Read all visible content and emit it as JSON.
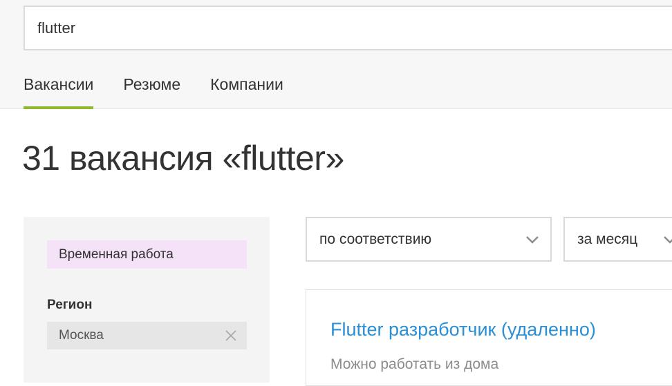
{
  "search": {
    "value": "flutter"
  },
  "tabs": [
    {
      "label": "Вакансии",
      "active": true
    },
    {
      "label": "Резюме",
      "active": false
    },
    {
      "label": "Компании",
      "active": false
    }
  ],
  "page_title": "31 вакансия «flutter»",
  "filters": {
    "tag": "Временная работа",
    "region_label": "Регион",
    "region_value": "Москва"
  },
  "sort": {
    "order": "по соответствию",
    "period": "за месяц"
  },
  "results": [
    {
      "title": "Flutter разработчик (удаленно)",
      "subtitle": "Можно работать из дома"
    }
  ],
  "colors": {
    "accent_underline": "#8fb92a",
    "link": "#2b8fd6",
    "tag_bg": "#f6e2f8"
  },
  "icons": {
    "clear_region": "close-icon",
    "select_arrow": "chevron-down-icon"
  }
}
